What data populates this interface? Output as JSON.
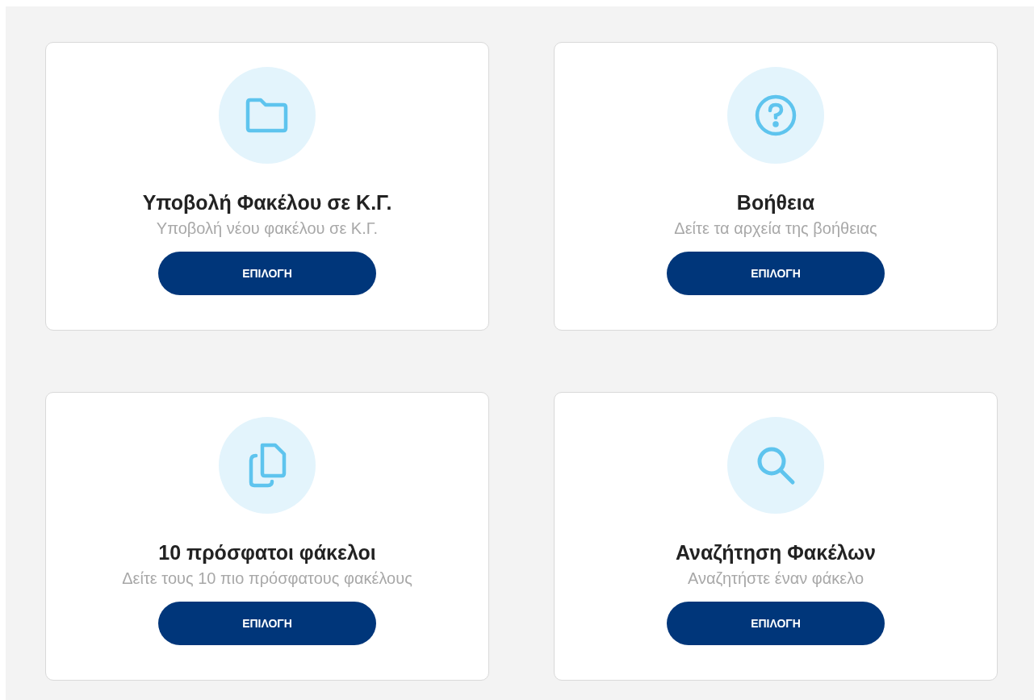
{
  "cards": [
    {
      "kind": "folder",
      "title": "Υποβολή Φακέλου σε Κ.Γ.",
      "subtitle": "Υποβολή νέου φακέλου σε Κ.Γ.",
      "button": "ΕΠΙΛΟΓΗ"
    },
    {
      "kind": "help",
      "title": "Βοήθεια",
      "subtitle": "Δείτε τα αρχεία της βοήθειας",
      "button": "ΕΠΙΛΟΓΗ"
    },
    {
      "kind": "copy",
      "title": "10 πρόσφατοι φάκελοι",
      "subtitle": "Δείτε τους 10 πιο πρόσφατους φακέλους",
      "button": "ΕΠΙΛΟΓΗ"
    },
    {
      "kind": "search",
      "title": "Αναζήτηση Φακέλων",
      "subtitle": "Αναζητήστε έναν φάκελο",
      "button": "ΕΠΙΛΟΓΗ"
    }
  ]
}
